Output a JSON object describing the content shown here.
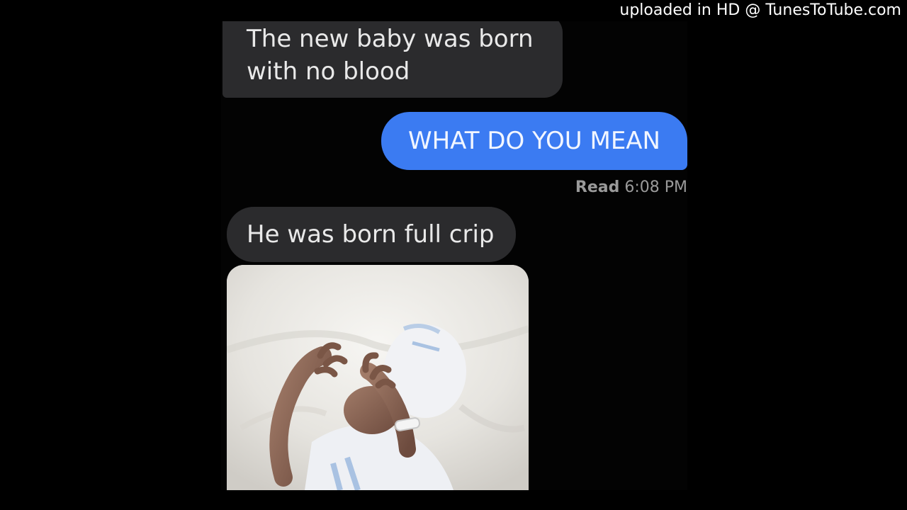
{
  "watermark": {
    "text": "uploaded in HD @ TunesToTube.com"
  },
  "conversation": {
    "incoming_1": {
      "line1": "The new baby was born",
      "line2": "with no blood"
    },
    "outgoing_1": {
      "text": "WHAT DO YOU MEAN"
    },
    "read_receipt": {
      "label": "Read",
      "time": "6:08 PM"
    },
    "incoming_2": {
      "text": "He was born full crip"
    },
    "image": {
      "alt": "baby-photo"
    }
  },
  "colors": {
    "background": "#000000",
    "incoming_bubble": "#2b2b2d",
    "outgoing_bubble": "#3b7bf2",
    "receipt_text": "#9a9a9a"
  }
}
